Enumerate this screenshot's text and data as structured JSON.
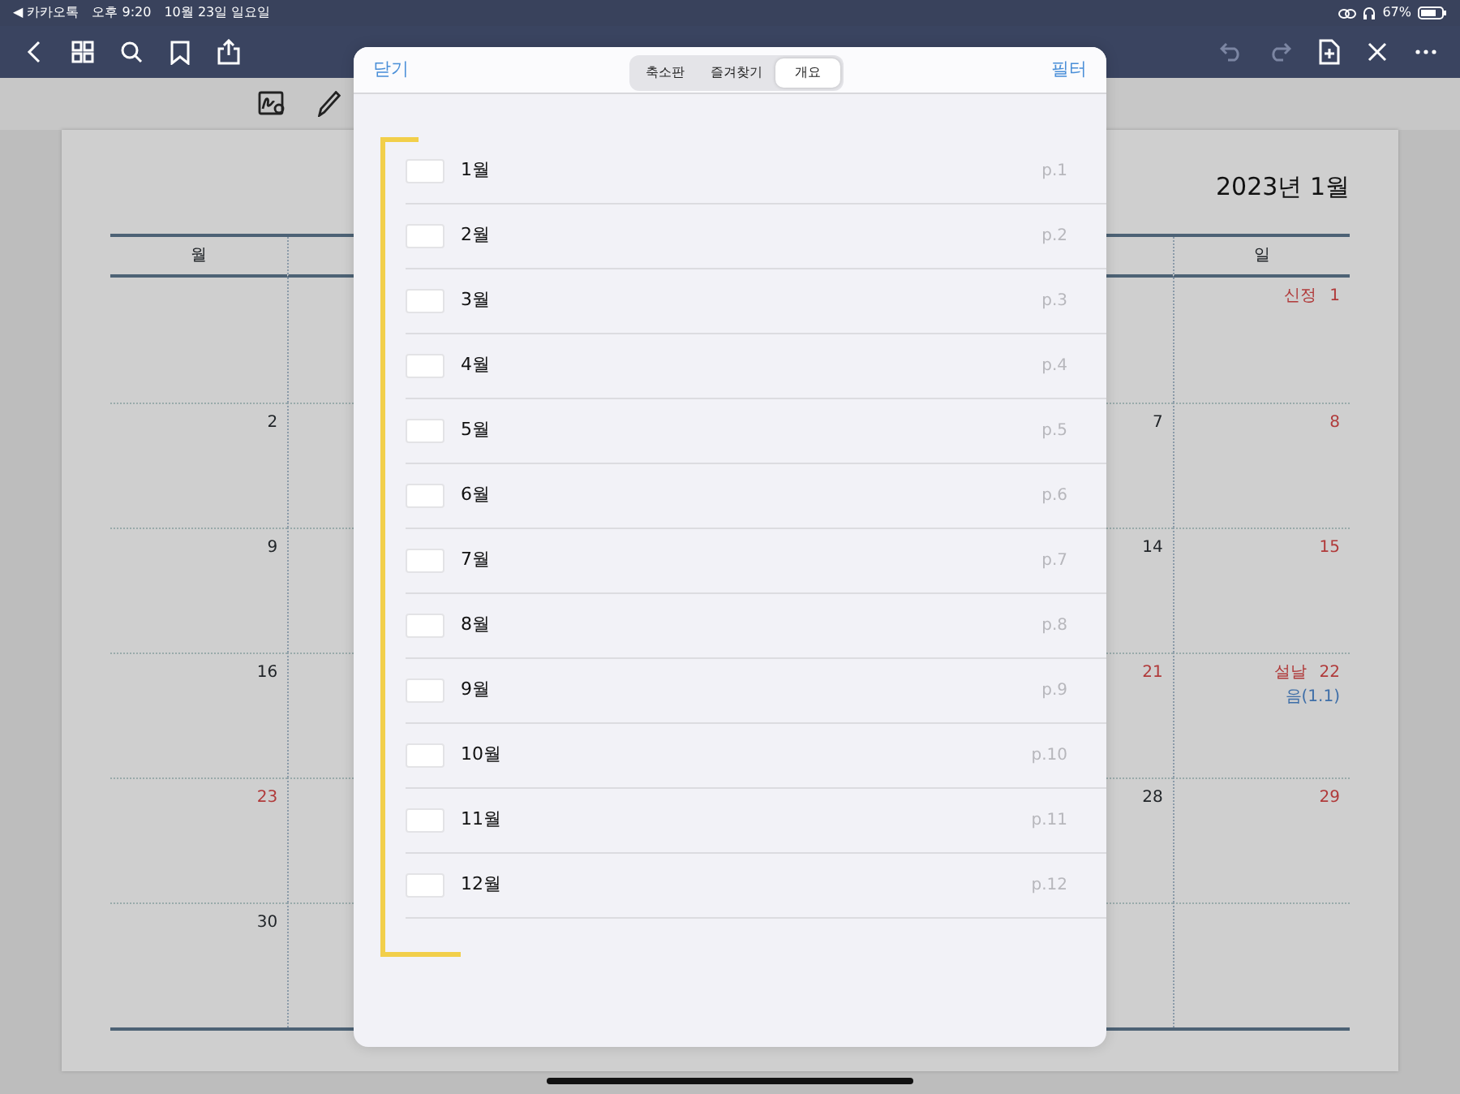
{
  "status_bar": {
    "back_app": "◀ 카카오톡",
    "time": "오후 9:20",
    "date": "10월 23일 일요일",
    "battery": "67%"
  },
  "calendar": {
    "title": "2023년 1월",
    "headers": {
      "monday": "월",
      "sunday": "일"
    },
    "weeks": [
      {
        "sunday": {
          "day": "1",
          "label": "신정",
          "holiday": true
        }
      },
      {
        "monday": {
          "day": "2",
          "holiday": false
        },
        "saturday": {
          "day": "7",
          "holiday": false
        },
        "sunday": {
          "day": "8",
          "holiday": true
        }
      },
      {
        "monday": {
          "day": "9",
          "holiday": false
        },
        "saturday": {
          "day": "14",
          "holiday": false
        },
        "sunday": {
          "day": "15",
          "holiday": true
        }
      },
      {
        "monday": {
          "day": "16",
          "holiday": false
        },
        "saturday": {
          "day": "21",
          "holiday": true
        },
        "sunday": {
          "day": "22",
          "label": "설날",
          "lunar": "음(1.1)",
          "holiday": true
        }
      },
      {
        "monday": {
          "day": "23",
          "holiday": true
        },
        "saturday": {
          "day": "28",
          "holiday": false
        },
        "sunday": {
          "day": "29",
          "holiday": true
        }
      },
      {
        "monday": {
          "day": "30",
          "holiday": false
        }
      }
    ]
  },
  "popover": {
    "close": "닫기",
    "filter": "필터",
    "tabs": [
      {
        "label": "축소판",
        "selected": false
      },
      {
        "label": "즐겨찾기",
        "selected": false
      },
      {
        "label": "개요",
        "selected": true
      }
    ],
    "outline": [
      {
        "label": "1월",
        "page": "p.1"
      },
      {
        "label": "2월",
        "page": "p.2"
      },
      {
        "label": "3월",
        "page": "p.3"
      },
      {
        "label": "4월",
        "page": "p.4"
      },
      {
        "label": "5월",
        "page": "p.5"
      },
      {
        "label": "6월",
        "page": "p.6"
      },
      {
        "label": "7월",
        "page": "p.7"
      },
      {
        "label": "8월",
        "page": "p.8"
      },
      {
        "label": "9월",
        "page": "p.9"
      },
      {
        "label": "10월",
        "page": "p.10"
      },
      {
        "label": "11월",
        "page": "p.11"
      },
      {
        "label": "12월",
        "page": "p.12"
      }
    ]
  }
}
